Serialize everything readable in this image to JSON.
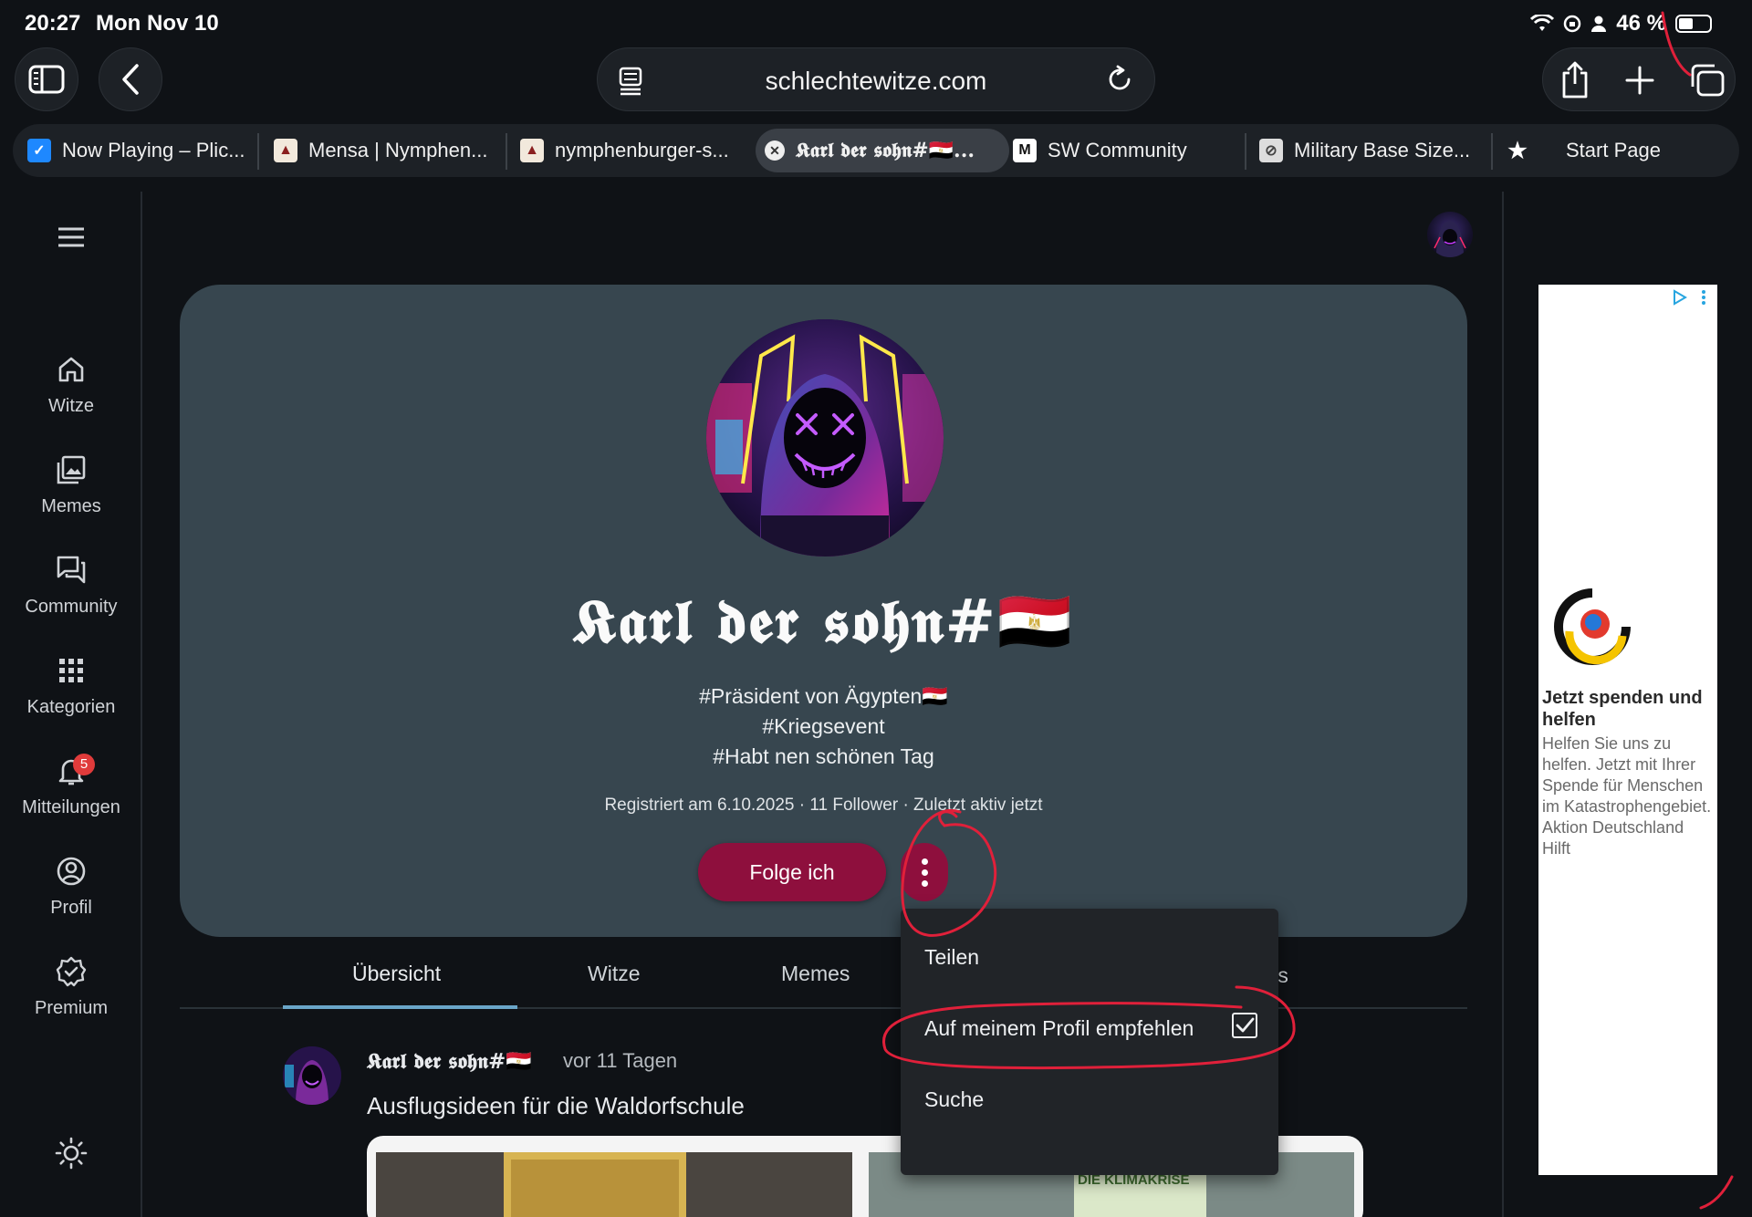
{
  "status_bar": {
    "time": "20:27",
    "date": "Mon Nov 10",
    "battery": "46 %"
  },
  "browser": {
    "url": "schlechtewitze.com",
    "tabs": [
      {
        "label": "Now Playing – Plic...",
        "icon": "checkbox-favicon"
      },
      {
        "label": "Mensa | Nymphen...",
        "icon": "castle-favicon"
      },
      {
        "label": "nymphenburger-s...",
        "icon": "castle-favicon"
      },
      {
        "label": "𝕶𝖆𝖗𝖑 𝖉𝖊𝖗 𝖘𝖔𝖍𝖓#🇪🇬...",
        "icon": "close-icon",
        "active": true
      },
      {
        "label": "SW Community",
        "icon": "m-favicon"
      },
      {
        "label": "Military Base Size...",
        "icon": "slash-favicon"
      },
      {
        "label": "Start Page",
        "icon": "star-icon"
      }
    ]
  },
  "nav": {
    "items": [
      {
        "label": "Witze",
        "icon": "home-icon"
      },
      {
        "label": "Memes",
        "icon": "gallery-icon"
      },
      {
        "label": "Community",
        "icon": "chat-icon"
      },
      {
        "label": "Kategorien",
        "icon": "grid-icon"
      },
      {
        "label": "Mitteilungen",
        "icon": "bell-icon",
        "badge": "5"
      },
      {
        "label": "Profil",
        "icon": "user-circle-icon"
      },
      {
        "label": "Premium",
        "icon": "verified-badge-icon"
      }
    ]
  },
  "profile": {
    "name": "𝕶𝖆𝖗𝖑 𝖉𝖊𝖗 𝖘𝖔𝖍𝖓#🇪🇬",
    "bio": [
      "#Präsident von Ägypten🇪🇬",
      "#Kriegsevent",
      "#Habt nen schönen Tag"
    ],
    "meta": "Registriert am 6.10.2025 · 11 Follower · Zuletzt aktiv jetzt",
    "follow_label": "Folge ich"
  },
  "profile_tabs": [
    "Übersicht",
    "Witze",
    "Memes"
  ],
  "profile_tabs_partial": "ts",
  "menu": {
    "items": [
      "Teilen",
      "Auf meinem Profil empfehlen",
      "Suche"
    ],
    "recommend_checked": true
  },
  "post": {
    "author": "𝕶𝖆𝖗𝖑 𝖉𝖊𝖗 𝖘𝖔𝖍𝖓#🇪🇬",
    "time": "vor 11 Tagen",
    "title": "Ausflugsideen für die Waldorfschule",
    "image_text": "SEID EHRLICH, DIE KLIMAKRISE"
  },
  "ad": {
    "title": "Jetzt spenden und helfen",
    "text": "Helfen Sie uns zu helfen. Jetzt mit Ihrer Spende für Menschen im Katastrophengebiet. Aktion Deutschland Hilft"
  },
  "colors": {
    "accent": "#8e0f3d",
    "card": "#37464f",
    "tab_underline": "#6aa6c8",
    "annotation": "#e0203a"
  }
}
